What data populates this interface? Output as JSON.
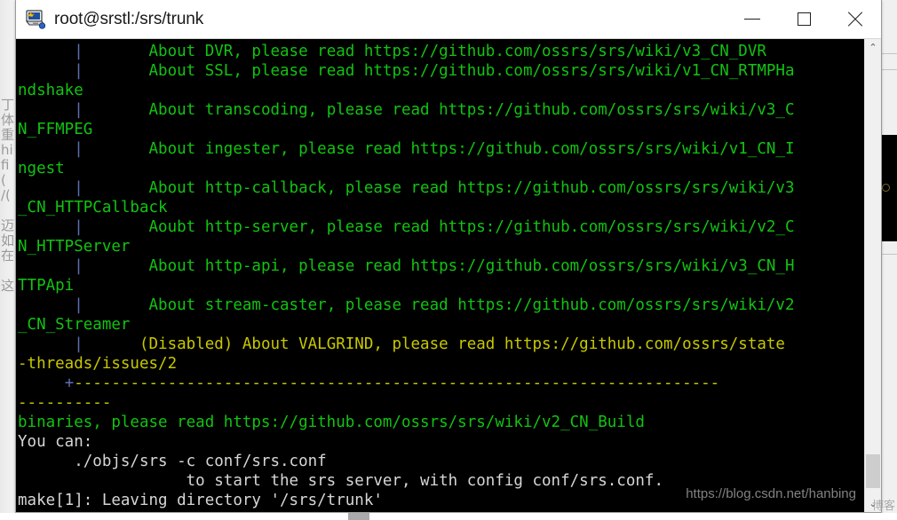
{
  "window": {
    "title": "root@srstl:/srs/trunk",
    "icon": "putty-terminal-icon",
    "controls": {
      "minimize_label": "—",
      "maximize_label": "□",
      "close_label": "✕",
      "minimize_name": "minimize",
      "maximize_name": "maximize",
      "close_name": "close"
    }
  },
  "terminal": {
    "background": "#000000",
    "colors": {
      "green": "#12c312",
      "yellow": "#c8c800",
      "white": "#d6d6d6",
      "blue": "#5c6fb0"
    },
    "lines": [
      {
        "id": 0,
        "segments": [
          {
            "text": "      ",
            "color": "green"
          },
          {
            "text": "|",
            "color": "blue"
          },
          {
            "text": "       About DVR, please read https://github.com/ossrs/srs/wiki/v3_CN_DVR",
            "color": "green"
          }
        ]
      },
      {
        "id": 1,
        "segments": [
          {
            "text": "      ",
            "color": "green"
          },
          {
            "text": "|",
            "color": "blue"
          },
          {
            "text": "       About SSL, please read https://github.com/ossrs/srs/wiki/v1_CN_RTMPHa",
            "color": "green"
          }
        ]
      },
      {
        "id": 2,
        "segments": [
          {
            "text": "ndshake",
            "color": "green"
          }
        ]
      },
      {
        "id": 3,
        "segments": [
          {
            "text": "      ",
            "color": "green"
          },
          {
            "text": "|",
            "color": "blue"
          },
          {
            "text": "       About transcoding, please read https://github.com/ossrs/srs/wiki/v3_C",
            "color": "green"
          }
        ]
      },
      {
        "id": 4,
        "segments": [
          {
            "text": "N_FFMPEG",
            "color": "green"
          }
        ]
      },
      {
        "id": 5,
        "segments": [
          {
            "text": "      ",
            "color": "green"
          },
          {
            "text": "|",
            "color": "blue"
          },
          {
            "text": "       About ingester, please read https://github.com/ossrs/srs/wiki/v1_CN_I",
            "color": "green"
          }
        ]
      },
      {
        "id": 6,
        "segments": [
          {
            "text": "ngest",
            "color": "green"
          }
        ]
      },
      {
        "id": 7,
        "segments": [
          {
            "text": "      ",
            "color": "green"
          },
          {
            "text": "|",
            "color": "blue"
          },
          {
            "text": "       About http-callback, please read https://github.com/ossrs/srs/wiki/v3",
            "color": "green"
          }
        ]
      },
      {
        "id": 8,
        "segments": [
          {
            "text": "_CN_HTTPCallback",
            "color": "green"
          }
        ]
      },
      {
        "id": 9,
        "segments": [
          {
            "text": "      ",
            "color": "green"
          },
          {
            "text": "|",
            "color": "blue"
          },
          {
            "text": "       Aoubt http-server, please read https://github.com/ossrs/srs/wiki/v2_C",
            "color": "green"
          }
        ]
      },
      {
        "id": 10,
        "segments": [
          {
            "text": "N_HTTPServer",
            "color": "green"
          }
        ]
      },
      {
        "id": 11,
        "segments": [
          {
            "text": "      ",
            "color": "green"
          },
          {
            "text": "|",
            "color": "blue"
          },
          {
            "text": "       About http-api, please read https://github.com/ossrs/srs/wiki/v3_CN_H",
            "color": "green"
          }
        ]
      },
      {
        "id": 12,
        "segments": [
          {
            "text": "TTPApi",
            "color": "green"
          }
        ]
      },
      {
        "id": 13,
        "segments": [
          {
            "text": "      ",
            "color": "green"
          },
          {
            "text": "|",
            "color": "blue"
          },
          {
            "text": "       About stream-caster, please read https://github.com/ossrs/srs/wiki/v2",
            "color": "green"
          }
        ]
      },
      {
        "id": 14,
        "segments": [
          {
            "text": "_CN_Streamer",
            "color": "green"
          }
        ]
      },
      {
        "id": 15,
        "segments": [
          {
            "text": "      ",
            "color": "yellow"
          },
          {
            "text": "|",
            "color": "blue"
          },
          {
            "text": "      (Disabled) About VALGRIND, please read https://github.com/ossrs/state",
            "color": "yellow"
          }
        ]
      },
      {
        "id": 16,
        "segments": [
          {
            "text": "-threads/issues/2",
            "color": "yellow"
          }
        ]
      },
      {
        "id": 17,
        "segments": [
          {
            "text": "     ",
            "color": "yellow"
          },
          {
            "text": "+",
            "color": "blue"
          },
          {
            "text": "---------------------------------------------------------------------",
            "color": "yellow"
          }
        ]
      },
      {
        "id": 18,
        "segments": [
          {
            "text": "----------",
            "color": "yellow"
          }
        ]
      },
      {
        "id": 19,
        "segments": [
          {
            "text": "binaries, please read https://github.com/ossrs/srs/wiki/v2_CN_Build",
            "color": "green"
          }
        ]
      },
      {
        "id": 20,
        "segments": [
          {
            "text": "You can:",
            "color": "white"
          }
        ]
      },
      {
        "id": 21,
        "segments": [
          {
            "text": "      ./objs/srs -c conf/srs.conf",
            "color": "white"
          }
        ]
      },
      {
        "id": 22,
        "segments": [
          {
            "text": "                  to start the srs server, with config conf/srs.conf.",
            "color": "white"
          }
        ]
      },
      {
        "id": 23,
        "segments": [
          {
            "text": "make[1]: Leaving directory '/srs/trunk'",
            "color": "white"
          }
        ]
      }
    ],
    "scrollbar": {
      "up_arrow": "⌃",
      "down_arrow": "⌄"
    }
  },
  "watermark": {
    "url": "https://blog.csdn.net/hanbing",
    "cn": "博客"
  },
  "background": {
    "left_strip_glyphs": "丁\n体\n重\nhi\nfi\n(\n/(\n\n迈\n如\n在\n\n这为"
  }
}
